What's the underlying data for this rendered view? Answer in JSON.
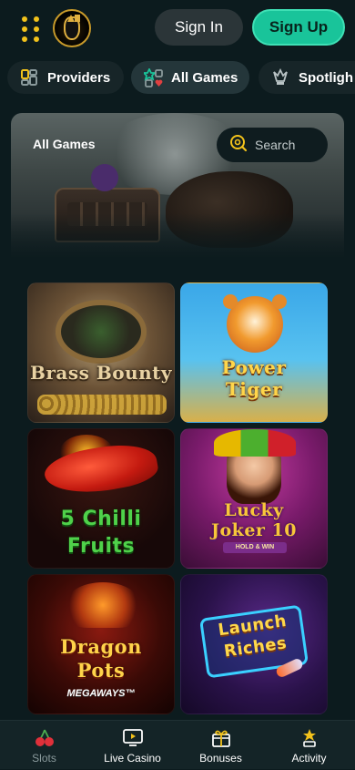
{
  "header": {
    "menu_icon": "grid-dots-icon",
    "logo": "black-cat-logo",
    "signin_label": "Sign In",
    "signup_label": "Sign Up"
  },
  "tabs": [
    {
      "label": "Providers",
      "icon": "providers-icon"
    },
    {
      "label": "All Games",
      "icon": "all-games-icon",
      "active": true
    },
    {
      "label": "Spotligh",
      "icon": "spotlight-icon"
    }
  ],
  "banner": {
    "title": "All Games",
    "search_placeholder": "Search"
  },
  "games": [
    {
      "title_line1": "Brass Bounty",
      "title_line2": ""
    },
    {
      "title_line1": "Power",
      "title_line2": "Tiger"
    },
    {
      "title_line1": "5 Chilli",
      "title_line2": "Fruits"
    },
    {
      "title_line1": "Lucky",
      "title_line2": "Joker 10",
      "badge": "HOLD & WIN"
    },
    {
      "title_line1": "Dragon",
      "title_line2": "Pots",
      "badge": "MEGAWAYS™"
    },
    {
      "title_line1": "Launch",
      "title_line2": "Riches"
    }
  ],
  "bottom_nav": [
    {
      "label": "Slots",
      "icon": "cherry-icon",
      "active": true
    },
    {
      "label": "Live Casino",
      "icon": "tv-icon"
    },
    {
      "label": "Bonuses",
      "icon": "gift-icon"
    },
    {
      "label": "Activity",
      "icon": "star-trophy-icon"
    }
  ],
  "colors": {
    "accent": "#19c49a",
    "gold": "#f2c21b",
    "background": "#0c1b1e"
  }
}
